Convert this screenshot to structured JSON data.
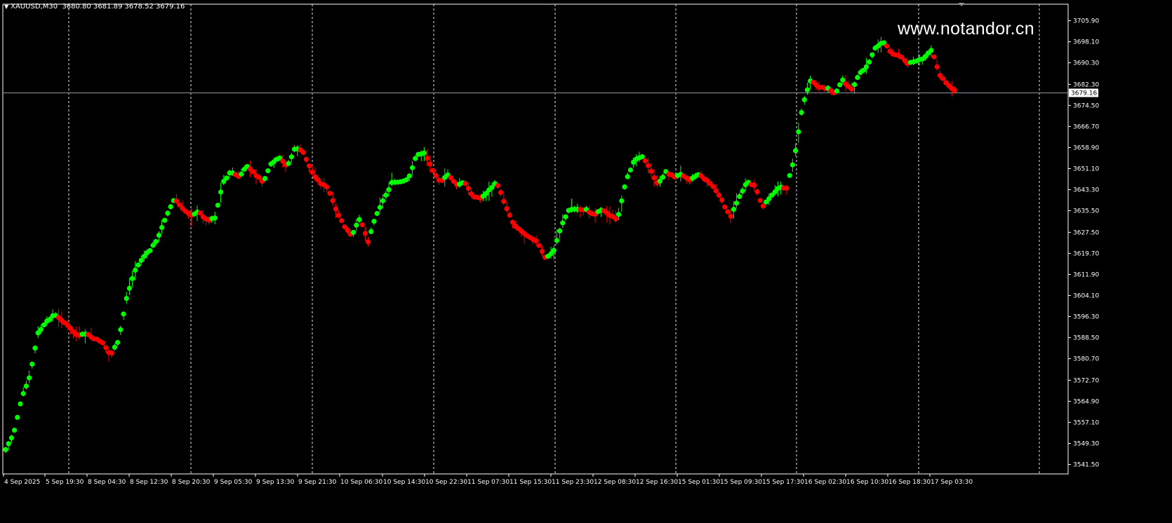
{
  "header": {
    "symbol": "XAUUSD,M30",
    "ohlc": "3680.80 3681.89 3678.52 3679.16"
  },
  "watermark": "www.notandor.cn",
  "colors": {
    "background": "#000000",
    "bull": "#00ff00",
    "bear": "#ff0000",
    "grid": "#ffffff",
    "bid_line": "#8f9aa6"
  },
  "chart_data": {
    "type": "line",
    "title": "",
    "xlabel": "",
    "ylabel": "",
    "ylim": [
      3538.0,
      3712.0
    ],
    "y_ticks": [
      "3705.90",
      "3698.10",
      "3690.30",
      "3682.30",
      "3674.50",
      "3666.70",
      "3658.90",
      "3651.10",
      "3643.30",
      "3635.50",
      "3627.50",
      "3619.70",
      "3611.90",
      "3604.10",
      "3596.30",
      "3588.50",
      "3580.70",
      "3572.70",
      "3564.90",
      "3557.10",
      "3549.30",
      "3541.50"
    ],
    "x_labels": [
      "4 Sep 2025",
      "5 Sep 19:30",
      "8 Sep 04:30",
      "8 Sep 12:30",
      "8 Sep 20:30",
      "9 Sep 05:30",
      "9 Sep 13:30",
      "9 Sep 21:30",
      "10 Sep 06:30",
      "10 Sep 14:30",
      "10 Sep 22:30",
      "11 Sep 07:30",
      "11 Sep 15:30",
      "11 Sep 23:30",
      "12 Sep 08:30",
      "12 Sep 16:30",
      "15 Sep 01:30",
      "15 Sep 09:30",
      "15 Sep 17:30",
      "16 Sep 02:30",
      "16 Sep 10:30",
      "16 Sep 18:30",
      "17 Sep 03:30"
    ],
    "current_price": "3679.16",
    "grid": "vertical dashed",
    "series": [
      {
        "values": [
          [
            0,
            3547
          ],
          [
            1,
            3553
          ],
          [
            2,
            3566
          ],
          [
            3,
            3574
          ],
          [
            4,
            3590
          ],
          [
            5,
            3594
          ],
          [
            6,
            3597
          ],
          [
            7,
            3595
          ],
          [
            8,
            3592
          ],
          [
            9,
            3589
          ],
          [
            10,
            3590
          ],
          [
            11,
            3588
          ],
          [
            12,
            3587
          ],
          [
            13,
            3582
          ],
          [
            14,
            3587
          ],
          [
            15,
            3603
          ],
          [
            16,
            3613
          ],
          [
            17,
            3618
          ],
          [
            18,
            3621
          ],
          [
            19,
            3626
          ],
          [
            20,
            3634
          ],
          [
            21,
            3640
          ],
          [
            22,
            3636
          ],
          [
            23,
            3634
          ],
          [
            24,
            3635
          ],
          [
            25,
            3632
          ],
          [
            26,
            3633
          ],
          [
            27,
            3646
          ],
          [
            28,
            3650
          ],
          [
            29,
            3648
          ],
          [
            30,
            3652
          ],
          [
            31,
            3649
          ],
          [
            32,
            3646
          ],
          [
            33,
            3653
          ],
          [
            34,
            3655
          ],
          [
            35,
            3652
          ],
          [
            36,
            3659
          ],
          [
            37,
            3657
          ],
          [
            38,
            3650
          ],
          [
            39,
            3646
          ],
          [
            40,
            3644
          ],
          [
            41,
            3636
          ],
          [
            42,
            3630
          ],
          [
            43,
            3626
          ],
          [
            44,
            3633
          ],
          [
            45,
            3624
          ],
          [
            46,
            3634
          ],
          [
            47,
            3640
          ],
          [
            48,
            3646
          ],
          [
            49,
            3646
          ],
          [
            50,
            3647
          ],
          [
            51,
            3656
          ],
          [
            52,
            3657
          ],
          [
            53,
            3651
          ],
          [
            54,
            3646
          ],
          [
            55,
            3649
          ],
          [
            56,
            3645
          ],
          [
            57,
            3646
          ],
          [
            58,
            3641
          ],
          [
            59,
            3640
          ],
          [
            60,
            3643
          ],
          [
            61,
            3646
          ],
          [
            62,
            3638
          ],
          [
            63,
            3631
          ],
          [
            64,
            3628
          ],
          [
            65,
            3626
          ],
          [
            66,
            3624
          ],
          [
            67,
            3618
          ],
          [
            68,
            3620
          ],
          [
            69,
            3630
          ],
          [
            70,
            3636
          ],
          [
            71,
            3636
          ],
          [
            72,
            3636
          ],
          [
            73,
            3634
          ],
          [
            74,
            3636
          ],
          [
            75,
            3634
          ],
          [
            76,
            3632
          ],
          [
            77,
            3646
          ],
          [
            78,
            3654
          ],
          [
            79,
            3656
          ],
          [
            80,
            3651
          ],
          [
            81,
            3645
          ],
          [
            82,
            3650
          ],
          [
            83,
            3648
          ],
          [
            84,
            3649
          ],
          [
            85,
            3647
          ],
          [
            86,
            3649
          ],
          [
            87,
            3647
          ],
          [
            88,
            3644
          ],
          [
            89,
            3639
          ],
          [
            90,
            3633
          ],
          [
            91,
            3640
          ],
          [
            92,
            3646
          ],
          [
            93,
            3645
          ],
          [
            94,
            3637
          ],
          [
            95,
            3641
          ],
          [
            96,
            3644
          ],
          [
            97,
            3644
          ],
          [
            98,
            3656
          ],
          [
            99,
            3675
          ],
          [
            100,
            3684
          ],
          [
            101,
            3681
          ],
          [
            102,
            3681
          ],
          [
            103,
            3679
          ],
          [
            104,
            3684
          ],
          [
            105,
            3680
          ],
          [
            106,
            3686
          ],
          [
            107,
            3689
          ],
          [
            108,
            3696
          ],
          [
            109,
            3698
          ],
          [
            110,
            3694
          ],
          [
            111,
            3693
          ],
          [
            112,
            3690
          ],
          [
            113,
            3691
          ],
          [
            114,
            3692
          ],
          [
            115,
            3695
          ],
          [
            116,
            3686
          ],
          [
            117,
            3682
          ],
          [
            118,
            3680
          ]
        ]
      }
    ]
  }
}
